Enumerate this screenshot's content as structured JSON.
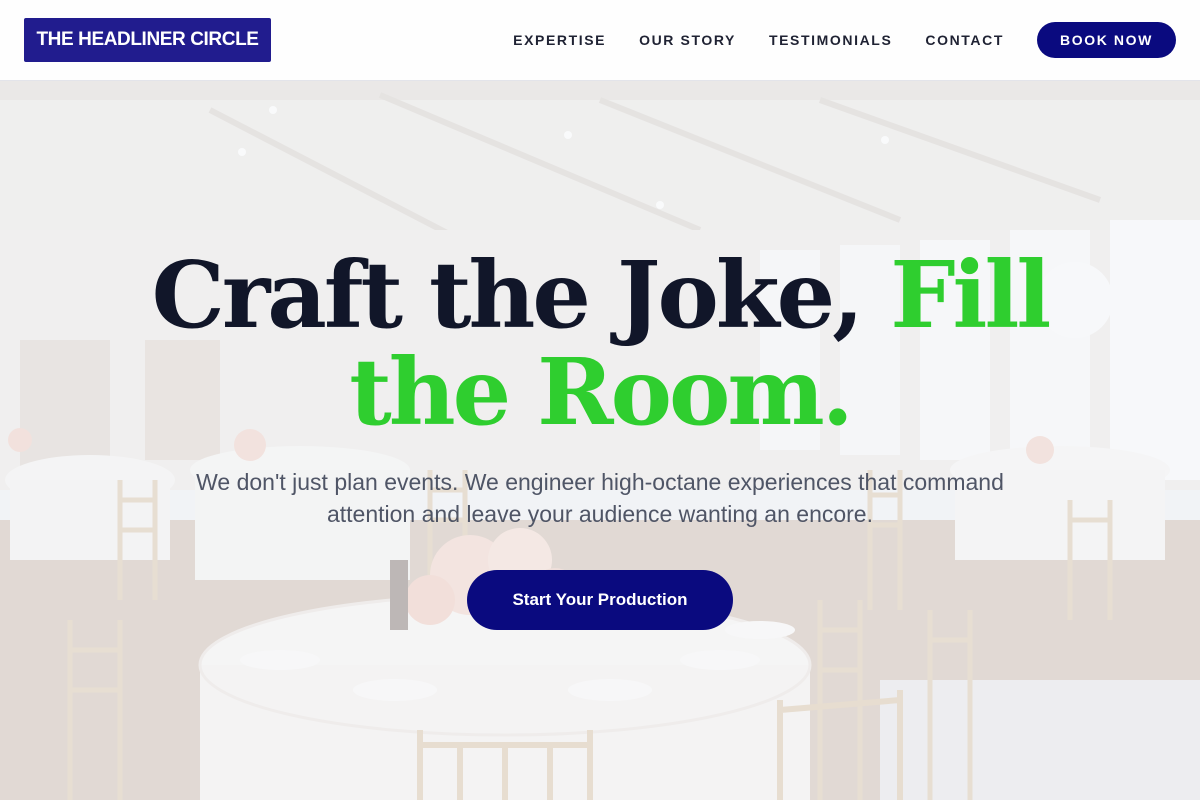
{
  "brand": {
    "name": "THE HEADLINER CIRCLE"
  },
  "nav": {
    "items": [
      "EXPERTISE",
      "OUR STORY",
      "TESTIMONIALS",
      "CONTACT"
    ],
    "book_label": "BOOK NOW"
  },
  "hero": {
    "headline_part1": "Craft the Joke, ",
    "headline_part2": "Fill the Room.",
    "subtext": "We don't just plan events. We engineer high-octane experiences that command attention and leave your audience wanting an encore.",
    "cta_label": "Start Your Production"
  },
  "colors": {
    "brand_navy": "#0a0a7f",
    "logo_bg": "#211c8e",
    "accent_green": "#2fce2f",
    "headline_dark": "#111629",
    "body_text": "#4f5566"
  }
}
